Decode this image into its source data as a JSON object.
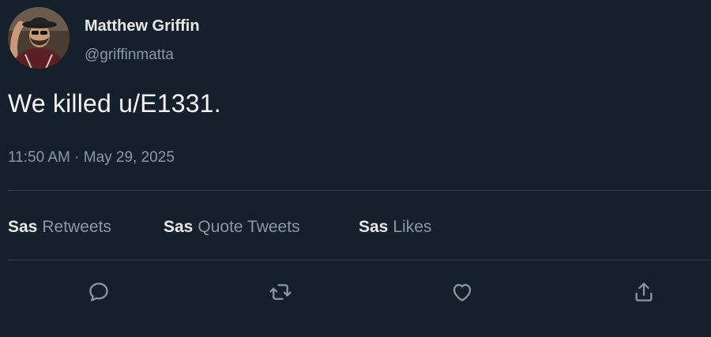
{
  "author": {
    "display_name": "Matthew Griffin",
    "handle": "@griffinmatta"
  },
  "tweet": {
    "text": "We killed u/E1331.",
    "timestamp": "11:50 AM · May 29, 2025"
  },
  "stats": [
    {
      "count": "Sas",
      "label": "Retweets"
    },
    {
      "count": "Sas",
      "label": "Quote Tweets"
    },
    {
      "count": "Sas",
      "label": "Likes"
    }
  ],
  "actions": [
    {
      "icon": "reply-icon"
    },
    {
      "icon": "retweet-icon"
    },
    {
      "icon": "like-icon"
    },
    {
      "icon": "share-icon"
    }
  ],
  "colors": {
    "background": "#15202b",
    "primary_text": "#e7e9ea",
    "secondary_text": "#8b98a5",
    "divider": "#38444d"
  }
}
